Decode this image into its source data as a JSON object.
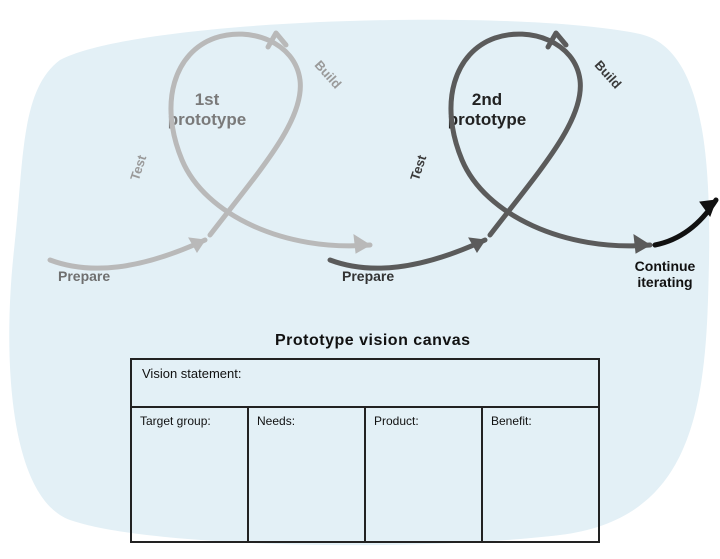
{
  "cycles": [
    {
      "title": "1st\nprototype",
      "prepare": "Prepare",
      "build": "Build",
      "test": "Test"
    },
    {
      "title": "2nd\nprototype",
      "prepare": "Prepare",
      "build": "Build",
      "test": "Test"
    }
  ],
  "continue_label": "Continue\niterating",
  "canvas": {
    "title": "Prototype vision canvas",
    "vision_label": "Vision statement:",
    "columns": [
      "Target group:",
      "Needs:",
      "Product:",
      "Benefit:"
    ]
  }
}
